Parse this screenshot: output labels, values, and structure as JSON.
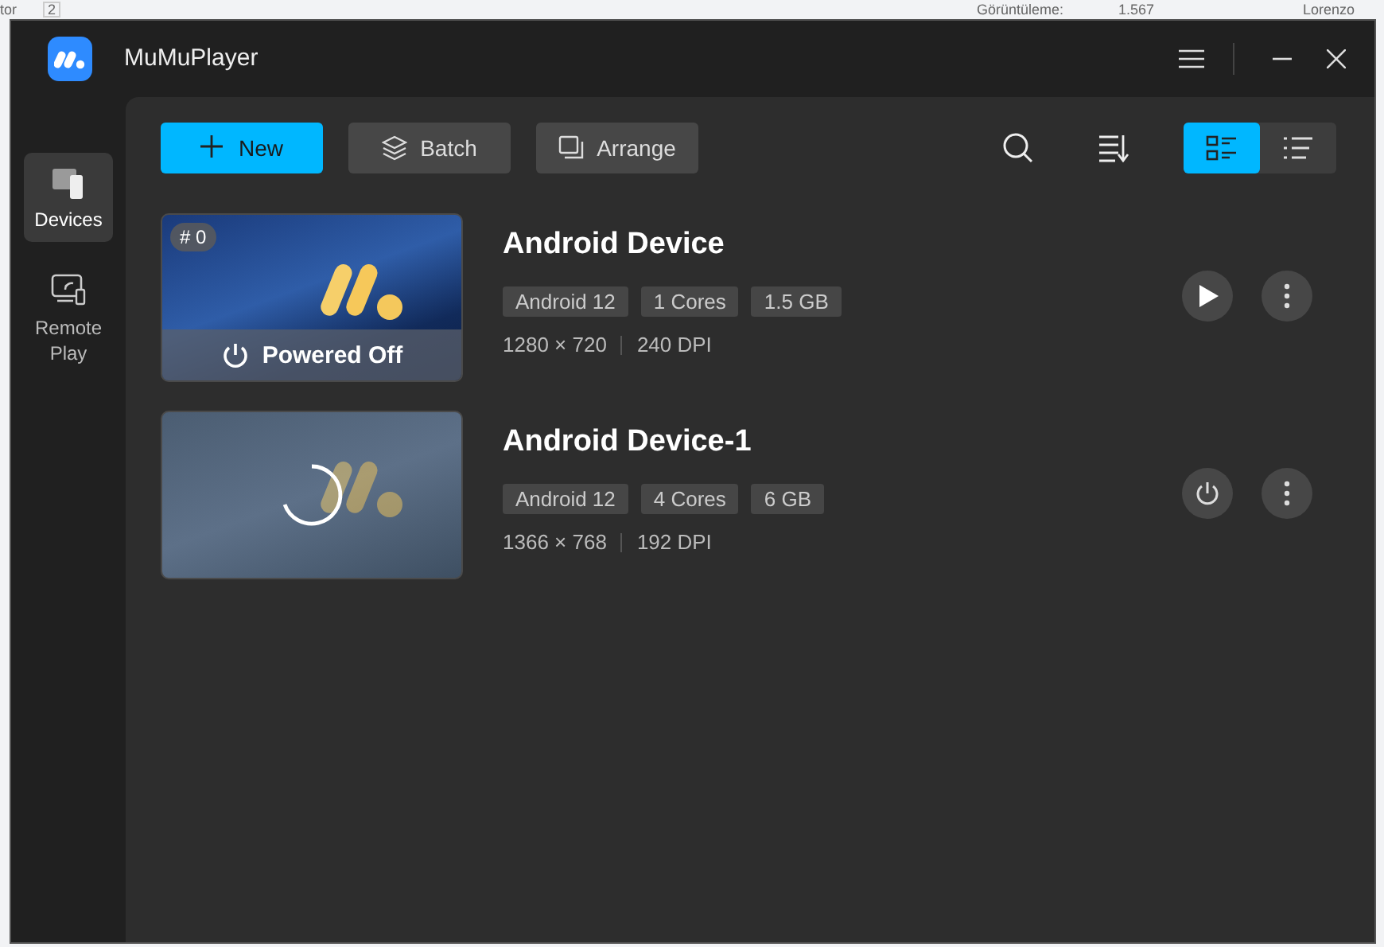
{
  "background_page": {
    "texts": [
      "tor",
      "2",
      "Görüntüleme:",
      "1.567",
      "Lorenzo"
    ]
  },
  "window": {
    "title": "MuMuPlayer"
  },
  "sidebar": {
    "items": [
      {
        "label": "Devices",
        "kind": "devices",
        "selected": true
      },
      {
        "label": "Remote Play",
        "kind": "remote",
        "selected": false
      }
    ]
  },
  "toolbar": {
    "buttons": [
      {
        "label": "New",
        "kind": "new"
      },
      {
        "label": "Batch",
        "kind": "batch"
      },
      {
        "label": "Arrange",
        "kind": "arrange"
      }
    ],
    "view_modes": [
      {
        "kind": "grid",
        "selected": true
      },
      {
        "kind": "list",
        "selected": false
      }
    ]
  },
  "devices": [
    {
      "badge": "# 0",
      "name": "Android Device",
      "kind": "off",
      "status": "Powered Off",
      "tags": [
        "Android 12",
        "1 Cores",
        "1.5 GB"
      ],
      "resolution": "1280 × 720",
      "dpi": "240 DPI"
    },
    {
      "name": "Android Device-1",
      "kind": "loading",
      "tags": [
        "Android 12",
        "4 Cores",
        "6 GB"
      ],
      "resolution": "1366 × 768",
      "dpi": "192 DPI"
    }
  ]
}
